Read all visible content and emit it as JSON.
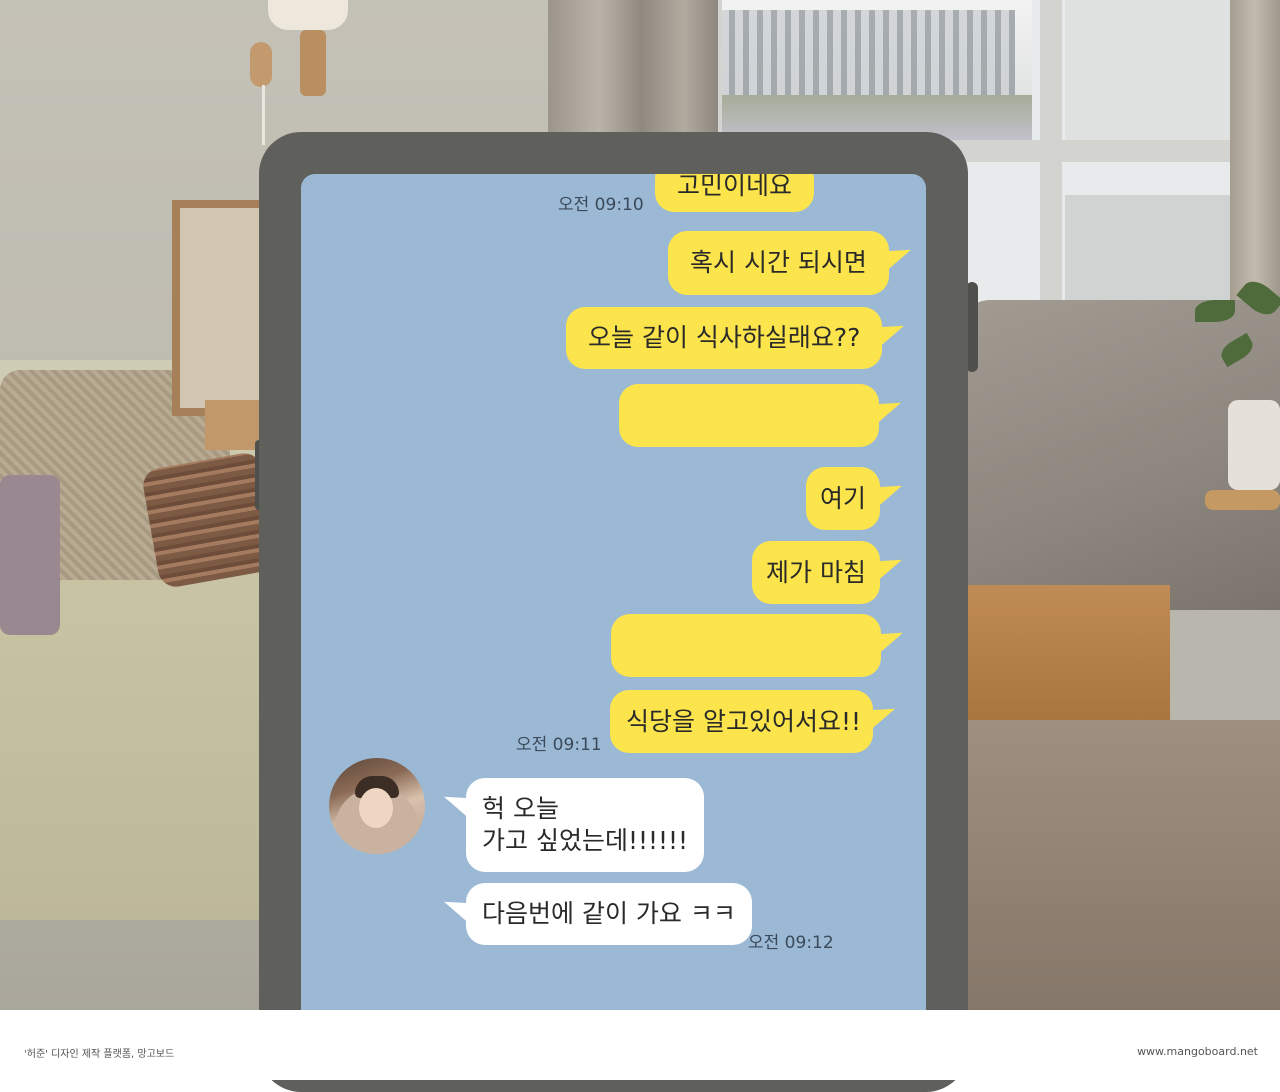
{
  "chat": {
    "messages": [
      {
        "sender": "me",
        "text": "고민이네요"
      },
      {
        "sender": "me",
        "text": "혹시 시간 되시면"
      },
      {
        "sender": "me",
        "text": "오늘 같이 식사하실래요??"
      },
      {
        "sender": "me",
        "text": ""
      },
      {
        "sender": "me",
        "text": "여기"
      },
      {
        "sender": "me",
        "text": "제가 마침"
      },
      {
        "sender": "me",
        "text": ""
      },
      {
        "sender": "me",
        "text": "식당을 알고있어서요!!"
      },
      {
        "sender": "other",
        "text_line1": "헉 오늘",
        "text_line2": "가고 싶었는데!!!!!!"
      },
      {
        "sender": "other",
        "text": "다음번에 같이 가요 ㅋㅋ"
      }
    ],
    "timestamps": {
      "t1": "오전 09:10",
      "t2": "오전 09:11",
      "t3": "오전 09:12"
    },
    "colors": {
      "chat_background": "#9bb9d5",
      "outgoing_bubble": "#fce44c",
      "incoming_bubble": "#ffffff"
    }
  },
  "footer": {
    "left_text": "'허준' 디자인 제작 플랫폼, 망고보드",
    "right_text": "www.mangoboard.net"
  }
}
